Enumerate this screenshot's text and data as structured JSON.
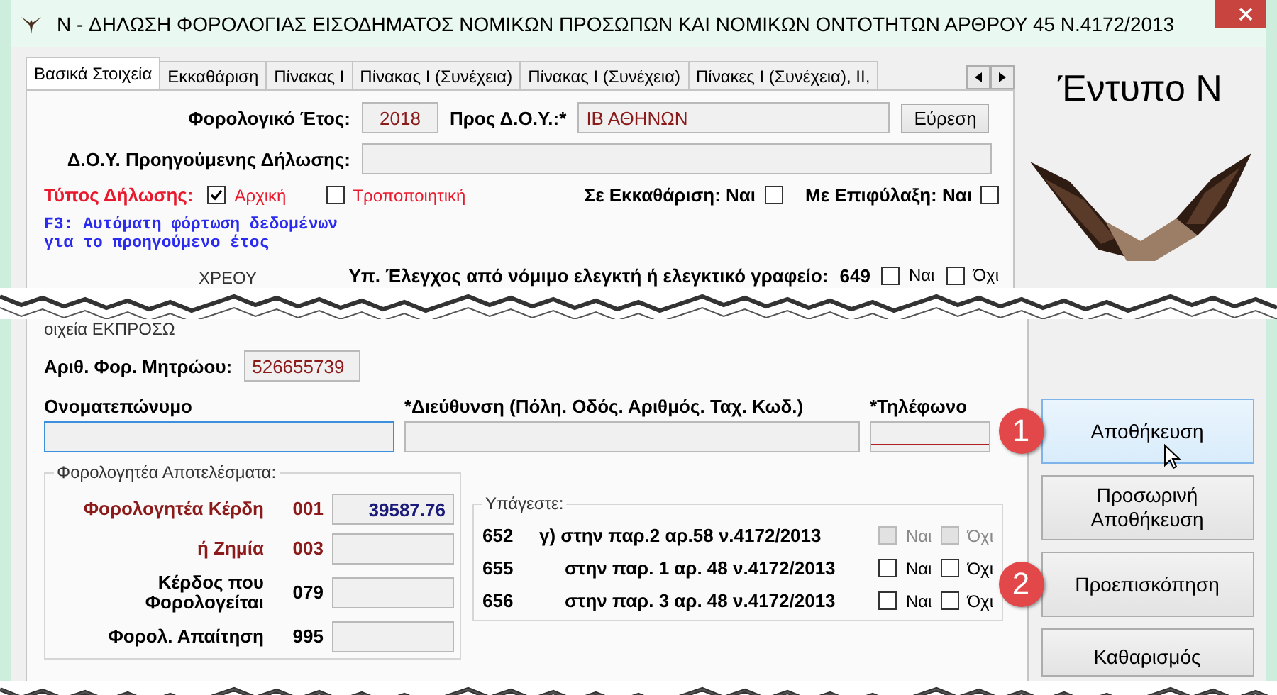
{
  "window": {
    "title": "N - ΔΗΛΩΣΗ ΦΟΡΟΛΟΓΙΑΣ ΕΙΣΟΔΗΜΑΤΟΣ ΝΟΜΙΚΩΝ ΠΡΟΣΩΠΩΝ ΚΑΙ ΝΟΜΙΚΩΝ ΟΝΤΟΤΗΤΩΝ ΑΡΘΡΟΥ 45 Ν.4172/2013"
  },
  "tabs": [
    {
      "label": "Βασικά Στοιχεία",
      "selected": true
    },
    {
      "label": "Εκκαθάριση",
      "selected": false
    },
    {
      "label": "Πίνακας Ι",
      "selected": false
    },
    {
      "label": "Πίνακας Ι (Συνέχεια)",
      "selected": false
    },
    {
      "label": "Πίνακας Ι (Συνέχεια)",
      "selected": false
    },
    {
      "label": "Πίνακες Ι (Συνέχεια), ΙΙ,",
      "selected": false
    }
  ],
  "form_title": "Έντυπο Ν",
  "basic": {
    "fiscal_year": {
      "label": "Φορολογικό Έτος:",
      "value": "2018"
    },
    "tax_office": {
      "label": "Προς Δ.Ο.Υ.:*",
      "value": "ΙΒ ΑΘΗΝΩΝ"
    },
    "search_button": "Εύρεση",
    "previous_office": {
      "label": "Δ.Ο.Υ. Προηγούμενης Δήλωσης:"
    },
    "declaration_type": {
      "label": "Τύπος Δήλωσης:",
      "options": [
        {
          "label": "Αρχική",
          "checked": true
        },
        {
          "label": "Τροποποιητική",
          "checked": false
        }
      ]
    },
    "flags": [
      {
        "label": "Σε Εκκαθάριση: Ναι",
        "checked": false
      },
      {
        "label": "Με Επιφύλαξη: Ναι",
        "checked": false
      }
    ],
    "hint": "F3: Αυτόματη φόρτωση δεδομένων\nγια το προηγούμενο έτος",
    "obligor_legend": "ΧΡΕΟΥ",
    "audit": {
      "label": "Υπ. Έλεγχος από νόμιμο ελεγκτή ή ελεγκτικό γραφείο:",
      "code": "649",
      "options": [
        {
          "label": "Ναι",
          "checked": false
        },
        {
          "label": "Όχι",
          "checked": false
        }
      ]
    }
  },
  "representative": {
    "legend": "οιχεία ΕΚΠΡΟΣΩ",
    "tin": {
      "label": "Αριθ. Φορ. Μητρώου:",
      "value": "526655739"
    },
    "fields": [
      {
        "label": "Ονοματεπώνυμο",
        "focused": true,
        "error": false
      },
      {
        "label": "*Διεύθυνση (Πόλη. Οδός. Αριθμός. Ταχ. Κωδ.)",
        "focused": false,
        "error": false
      },
      {
        "label": "*Τηλέφωνο",
        "focused": false,
        "error": true
      }
    ]
  },
  "results": {
    "legend": "Φορολογητέα Αποτελέσματα:",
    "rows": [
      {
        "label": "Φορολογητέα Κέρδη",
        "code": "001",
        "value": "39587.76",
        "emphasis": true
      },
      {
        "label": "ή Ζημία",
        "code": "003",
        "emphasis": true
      },
      {
        "label": "Κέρδος που Φορολογείται",
        "code": "079",
        "emphasis": false
      },
      {
        "label": "Φορολ. Απαίτηση",
        "code": "995",
        "emphasis": false
      }
    ]
  },
  "subject": {
    "legend": "Υπάγεστε:",
    "rows": [
      {
        "code": "652",
        "text": "γ) στην παρ.2 αρ.58 ν.4172/2013",
        "disabled": true,
        "options": [
          {
            "label": "Ναι",
            "checked": false
          },
          {
            "label": "Όχι",
            "checked": false
          }
        ]
      },
      {
        "code": "655",
        "text": "στην παρ. 1 αρ. 48 ν.4172/2013",
        "disabled": false,
        "options": [
          {
            "label": "Ναι",
            "checked": false
          },
          {
            "label": "Όχι",
            "checked": false
          }
        ]
      },
      {
        "code": "656",
        "text": "στην παρ. 3 αρ. 48 ν.4172/2013",
        "disabled": false,
        "options": [
          {
            "label": "Ναι",
            "checked": false
          },
          {
            "label": "Όχι",
            "checked": false
          }
        ]
      }
    ]
  },
  "buttons": [
    {
      "label": "Αποθήκευση",
      "hovered": true,
      "callout": "1"
    },
    {
      "label": "Προσωρινή Αποθήκευση",
      "hovered": false
    },
    {
      "label": "Προεπισκόπηση",
      "hovered": false,
      "callout": "2"
    },
    {
      "label": "Καθαρισμός",
      "hovered": false
    }
  ]
}
